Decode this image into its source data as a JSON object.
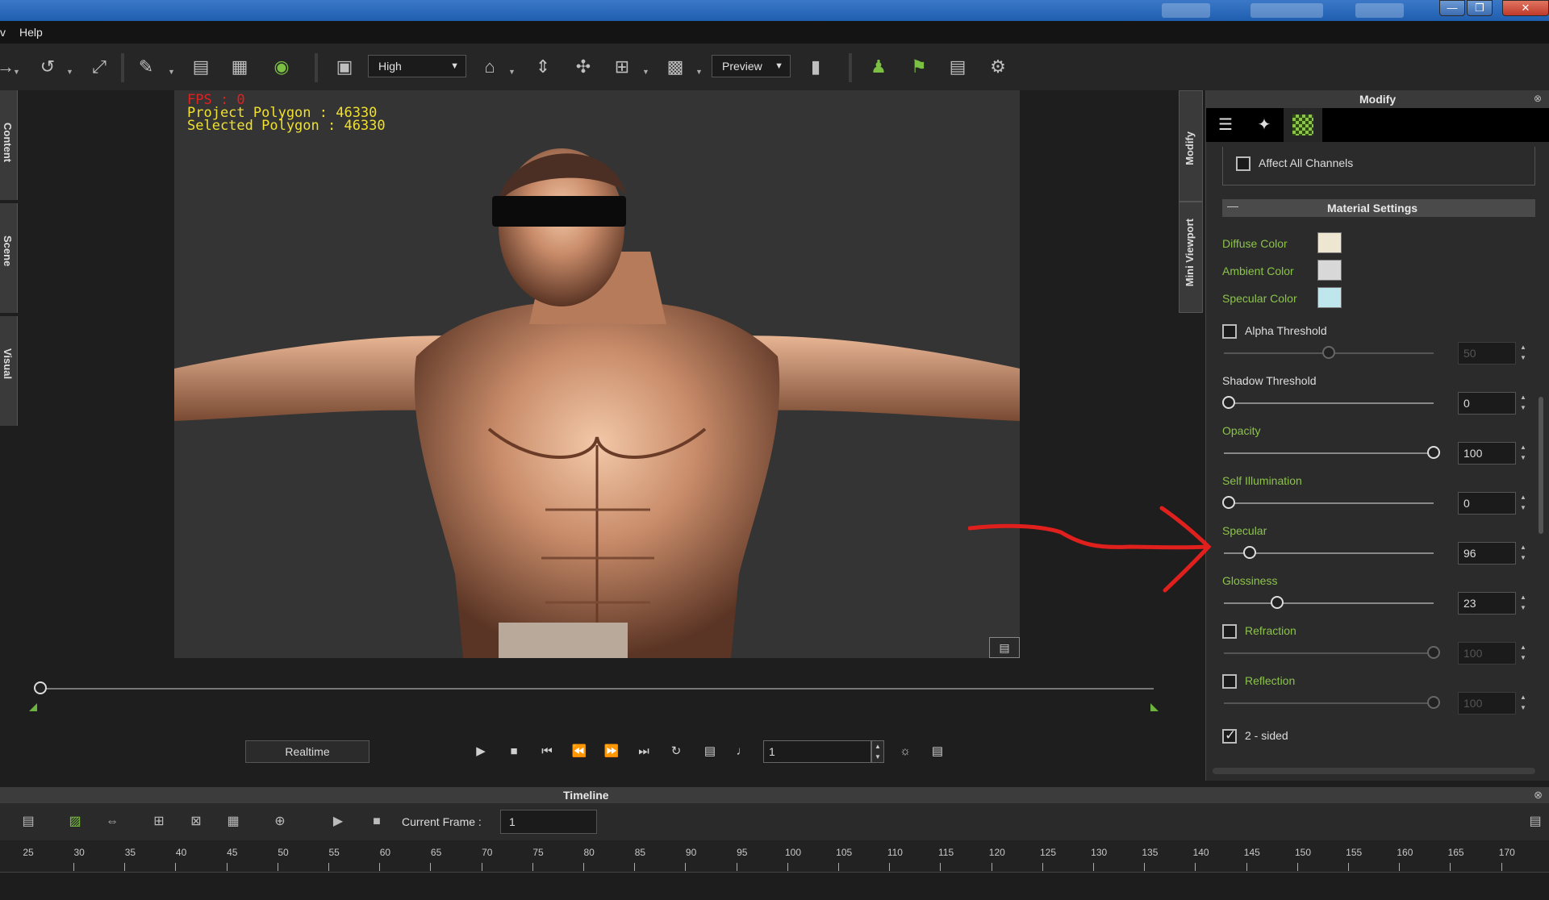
{
  "menu": {
    "left_fragment": "v",
    "help": "Help"
  },
  "toolbar": {
    "quality_value": "High",
    "preview_value": "Preview",
    "icons": [
      "pointer-icon",
      "undo-icon",
      "scale-icon",
      "pick-icon",
      "align-icon",
      "align-list-icon",
      "eye-icon",
      "window-icon",
      "home-icon",
      "fit-icon",
      "move-icon",
      "camera-preset-icon",
      "display-icon",
      "video-camera-icon",
      "pose-icon",
      "flag-icon",
      "clipboard-icon",
      "tool-icon"
    ]
  },
  "left_tabs": [
    "Content",
    "Scene",
    "Visual"
  ],
  "viewport": {
    "fps": "FPS : 0",
    "project_polygon": "Project Polygon : 46330",
    "selected_polygon": "Selected Polygon : 46330"
  },
  "playback": {
    "realtime_label": "Realtime",
    "frame_value": "1"
  },
  "timeline": {
    "title": "Timeline",
    "current_frame_label": "Current Frame :",
    "current_frame_value": "1",
    "ruler": [
      "25",
      "30",
      "35",
      "40",
      "45",
      "50",
      "55",
      "60",
      "65",
      "70",
      "75",
      "80",
      "85",
      "90",
      "95",
      "100",
      "105",
      "110",
      "115",
      "120",
      "125",
      "130",
      "135",
      "140",
      "145",
      "150",
      "155",
      "160",
      "165",
      "170"
    ]
  },
  "right_tabs": [
    "Modify",
    "Mini Viewport"
  ],
  "modify": {
    "title": "Modify",
    "affect_all_channels": "Affect All Channels",
    "material_settings": "Material Settings",
    "diffuse_color": "Diffuse Color",
    "ambient_color": "Ambient Color",
    "specular_color": "Specular Color",
    "colors": {
      "diffuse": "#efe6d2",
      "ambient": "#d8d8d8",
      "specular": "#bfe6ec"
    },
    "alpha_threshold": "Alpha Threshold",
    "alpha_threshold_value": "50",
    "shadow_threshold": "Shadow Threshold",
    "shadow_threshold_value": "0",
    "opacity": "Opacity",
    "opacity_value": "100",
    "self_illumination": "Self Illumination",
    "self_illumination_value": "0",
    "specular": "Specular",
    "specular_value": "96",
    "glossiness": "Glossiness",
    "glossiness_value": "23",
    "refraction": "Refraction",
    "refraction_value": "100",
    "reflection": "Reflection",
    "reflection_value": "100",
    "two_sided": "2 - sided"
  },
  "accent_colors": {
    "green": "#8bc34a",
    "annotation_red": "#e0201c"
  }
}
